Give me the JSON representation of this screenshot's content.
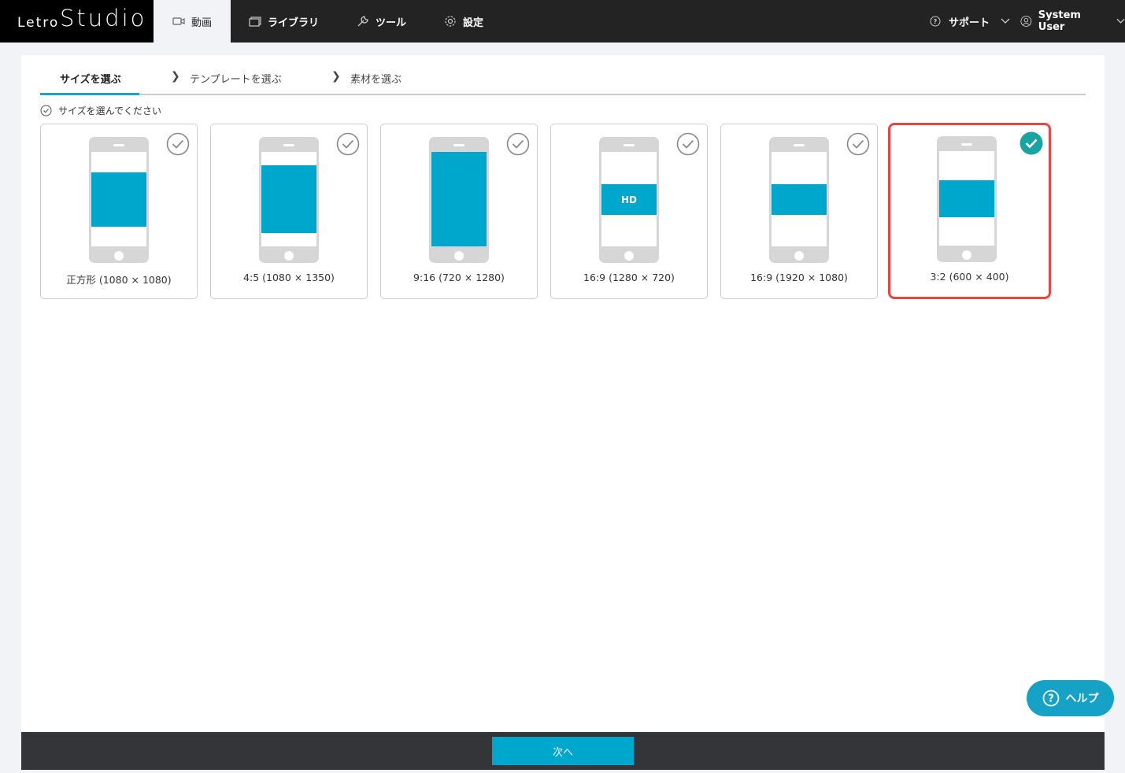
{
  "app": {
    "logo_small": "Letro",
    "logo_large": "Studio"
  },
  "nav": {
    "items": [
      {
        "label": "動画",
        "icon": "video-icon"
      },
      {
        "label": "ライブラリ",
        "icon": "library-icon"
      },
      {
        "label": "ツール",
        "icon": "wrench-icon"
      },
      {
        "label": "設定",
        "icon": "gear-icon"
      }
    ],
    "support_label": "サポート",
    "user_label": "System User"
  },
  "steps": {
    "items": [
      "サイズを選ぶ",
      "テンプレートを選ぶ",
      "素材を選ぶ"
    ],
    "active_index": 0
  },
  "hint": "サイズを選んでください",
  "sizes": [
    {
      "label": "正方形 (1080 × 1080)",
      "selected": false,
      "badge": ""
    },
    {
      "label": "4:5 (1080 × 1350)",
      "selected": false,
      "badge": ""
    },
    {
      "label": "9:16 (720 × 1280)",
      "selected": false,
      "badge": ""
    },
    {
      "label": "16:9 (1280 × 720)",
      "selected": false,
      "badge": "HD"
    },
    {
      "label": "16:9 (1920 × 1080)",
      "selected": false,
      "badge": ""
    },
    {
      "label": "3:2 (600 × 400)",
      "selected": true,
      "badge": ""
    }
  ],
  "footer": {
    "next_label": "次へ"
  },
  "help": {
    "label": "ヘルプ"
  },
  "colors": {
    "accent": "#00a7cc",
    "selected_border": "#e84545",
    "selected_check": "#1aa3a3",
    "topbar": "#232323"
  }
}
